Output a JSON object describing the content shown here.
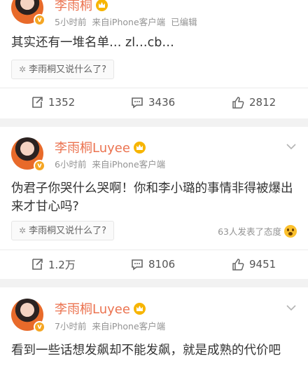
{
  "posts": [
    {
      "time": "5小时前",
      "source": "来自iPhone客户端",
      "edited": "已编辑",
      "text": "其实还有一堆名单… zl…cb…",
      "topic": "李雨桐又说什么了?",
      "actions": {
        "repost": "1352",
        "comment": "3436",
        "like": "2812"
      }
    },
    {
      "author": "李雨桐Luyee",
      "time": "6小时前",
      "source": "来自iPhone客户端",
      "text": "伪君子你哭什么哭啊！你和李小璐的事情非得被爆出来才甘心吗?",
      "topic": "李雨桐又说什么了?",
      "attitude": "63人发表了态度",
      "actions": {
        "repost": "1.2万",
        "comment": "8106",
        "like": "9451"
      }
    },
    {
      "author": "李雨桐Luyee",
      "time": "7小时前",
      "source": "来自iPhone客户端",
      "text": "看到一些话想发飙却不能发飙，就是成熟的代价吧"
    }
  ],
  "colors": {
    "name": "#eb7350",
    "meta": "#939393",
    "text": "#333333",
    "badge": "#f5a623"
  },
  "icons": [
    "avatar",
    "vip-badge",
    "crown-icon",
    "chevron-down-icon",
    "topic-icon",
    "repost-icon",
    "comment-icon",
    "like-icon",
    "surprised-emoji-icon"
  ]
}
